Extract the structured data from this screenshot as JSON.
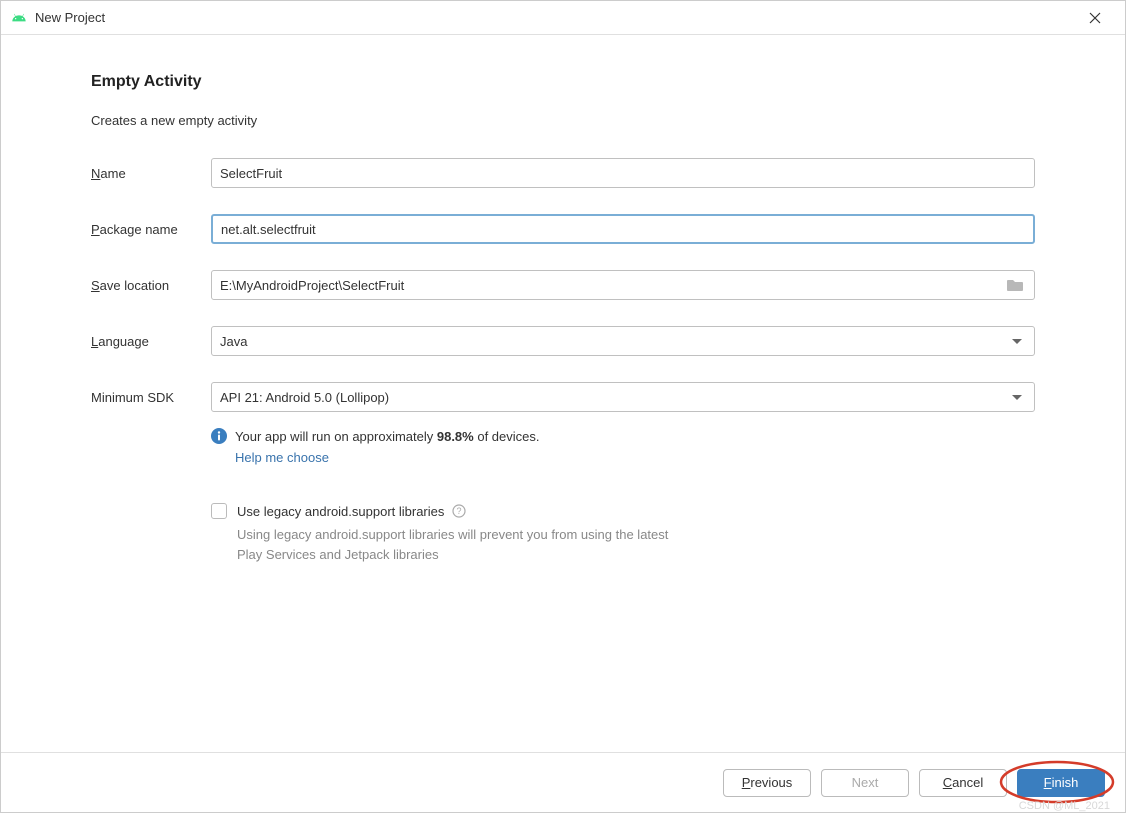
{
  "window": {
    "title": "New Project"
  },
  "heading": "Empty Activity",
  "subtitle": "Creates a new empty activity",
  "form": {
    "name": {
      "label_prefix": "N",
      "label_rest": "ame",
      "value": "SelectFruit"
    },
    "packageName": {
      "label_prefix": "P",
      "label_rest": "ackage name",
      "value": "net.alt.selectfruit"
    },
    "saveLocation": {
      "label_prefix": "S",
      "label_rest": "ave location",
      "value": "E:\\MyAndroidProject\\SelectFruit"
    },
    "language": {
      "label_prefix": "L",
      "label_rest": "anguage",
      "value": "Java"
    },
    "minSdk": {
      "label": "Minimum SDK",
      "value": "API 21: Android 5.0 (Lollipop)"
    }
  },
  "info": {
    "text_before": "Your app will run on approximately ",
    "percent": "98.8%",
    "text_after": " of devices.",
    "help_link": "Help me choose"
  },
  "legacy": {
    "label": "Use legacy android.support libraries",
    "hint": "Using legacy android.support libraries will prevent you from using the latest Play Services and Jetpack libraries"
  },
  "buttons": {
    "previous_prefix": "P",
    "previous_rest": "revious",
    "next": "Next",
    "cancel_prefix": "C",
    "cancel_rest": "ancel",
    "finish_prefix": "F",
    "finish_rest": "inish"
  },
  "watermark": "CSDN @ML_2021"
}
